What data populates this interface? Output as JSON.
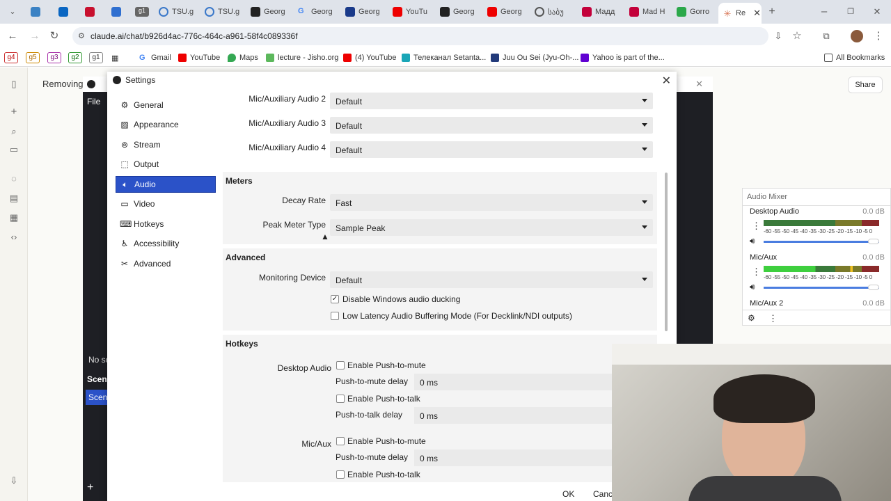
{
  "browser": {
    "tabs": [
      {
        "label": ""
      },
      {
        "label": ""
      },
      {
        "label": ""
      },
      {
        "label": ""
      },
      {
        "label": "g1"
      },
      {
        "label": "TSU.g"
      },
      {
        "label": "TSU.g"
      },
      {
        "label": "Georg"
      },
      {
        "label": "Georg"
      },
      {
        "label": "Georg"
      },
      {
        "label": "YouTu"
      },
      {
        "label": "Georg"
      },
      {
        "label": "Georg"
      },
      {
        "label": "საბუ"
      },
      {
        "label": "Мадд"
      },
      {
        "label": "Mad H"
      },
      {
        "label": "Gorro"
      },
      {
        "label": "Re"
      }
    ],
    "url": "claude.ai/chat/b926d4ac-776c-464c-a961-58f4c089336f",
    "bookmarks": {
      "badges": [
        "g4",
        "g5",
        "g3",
        "g2",
        "g1"
      ],
      "items": [
        "Gmail",
        "YouTube",
        "Maps",
        "lecture - Jisho.org",
        "(4) YouTube",
        "Телеканал Setanta...",
        "Juu Ou Sei (Jyu-Oh-...",
        "Yahoo is part of the..."
      ],
      "all_bookmarks": "All Bookmarks"
    }
  },
  "claude": {
    "chat_title": "Removing",
    "share": "Share"
  },
  "obs": {
    "menu_file": "File",
    "no_source": "No sc",
    "scenes": "Scene",
    "scene_item": "Scene"
  },
  "settings": {
    "title": "Settings",
    "sidebar": [
      "General",
      "Appearance",
      "Stream",
      "Output",
      "Audio",
      "Video",
      "Hotkeys",
      "Accessibility",
      "Advanced"
    ],
    "selected": "Audio",
    "devices": [
      {
        "label": "Mic/Auxiliary Audio 2",
        "value": "Default"
      },
      {
        "label": "Mic/Auxiliary Audio 3",
        "value": "Default"
      },
      {
        "label": "Mic/Auxiliary Audio 4",
        "value": "Default"
      }
    ],
    "meters": {
      "heading": "Meters",
      "decay_label": "Decay Rate",
      "decay_value": "Fast",
      "peak_label": "Peak Meter Type",
      "peak_value": "Sample Peak"
    },
    "advanced": {
      "heading": "Advanced",
      "monitoring_label": "Monitoring Device",
      "monitoring_value": "Default",
      "ducking": "Disable Windows audio ducking",
      "ducking_checked": true,
      "low_latency": "Low Latency Audio Buffering Mode (For Decklink/NDI outputs)",
      "low_latency_checked": false
    },
    "hotkeys": {
      "heading": "Hotkeys",
      "desktop_label": "Desktop Audio",
      "mic_label": "Mic/Aux",
      "push_to_mute": "Enable Push-to-mute",
      "push_to_mute_delay": "Push-to-mute delay",
      "push_to_talk": "Enable Push-to-talk",
      "push_to_talk_delay": "Push-to-talk delay",
      "delay_value": "0 ms"
    },
    "ok": "OK",
    "cancel": "Cance"
  },
  "mixer": {
    "title": "Audio Mixer",
    "channels": [
      {
        "name": "Desktop Audio",
        "level": "0.0 dB"
      },
      {
        "name": "Mic/Aux",
        "level": "0.0 dB"
      },
      {
        "name": "Mic/Aux 2",
        "level": "0.0 dB"
      }
    ],
    "scale": "-60 -55 -50 -45 -40 -35 -30 -25 -20 -15 -10 -5 0"
  }
}
